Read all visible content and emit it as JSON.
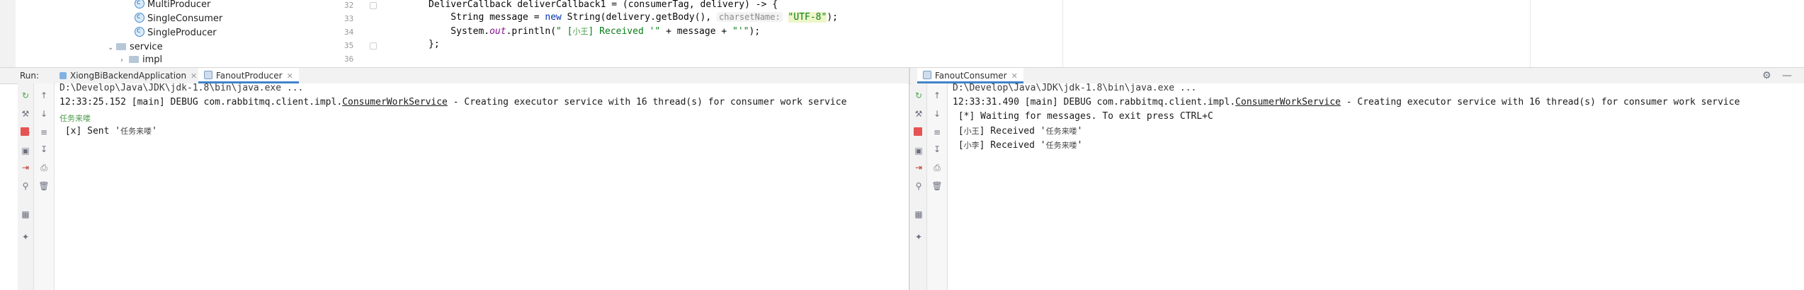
{
  "project_tree": {
    "items": [
      {
        "label": "MultiProducer",
        "kind": "class"
      },
      {
        "label": "SingleConsumer",
        "kind": "class"
      },
      {
        "label": "SingleProducer",
        "kind": "class"
      },
      {
        "label": "service",
        "kind": "folder"
      },
      {
        "label": "impl",
        "kind": "folder"
      }
    ]
  },
  "editor": {
    "line_numbers": [
      "32",
      "33",
      "34",
      "35",
      "36"
    ],
    "lines": [
      {
        "a": "DeliverCallback deliverCallback1 = (consumerTag, delivery) -> {"
      },
      {
        "a": "    String message = ",
        "kw": "new",
        "b": " String(delivery.getBody(), ",
        "hint": "charsetName:",
        "str": "\"UTF-8\"",
        "c": ");"
      },
      {
        "a": "    System.",
        "static": "out",
        "b": ".println(",
        "str1": "\" [",
        "cjk": "小王",
        "str2": "] Received '\"",
        "c": " + message + ",
        "str3": "\"'\"",
        "d": ");"
      },
      {
        "a": "};"
      }
    ]
  },
  "run_window": {
    "run_label": "Run:",
    "left_tabs": [
      {
        "label": "XiongBiBackendApplication",
        "active": false
      },
      {
        "label": "FanoutProducer",
        "active": true
      }
    ],
    "right_tabs": [
      {
        "label": "FanoutConsumer",
        "active": true
      }
    ],
    "producer_console": {
      "path_line": "D:\\Develop\\Java\\JDK\\jdk-1.8\\bin\\java.exe ...",
      "debug_prefix": "12:33:25.152 [main] DEBUG com.rabbitmq.client.impl.",
      "debug_class": "ConsumerWorkService",
      "debug_suffix": " - Creating executor service with 16 thread(s) for consumer work service",
      "line3_cjk": "任务来喽",
      "sent_prefix": " [x] Sent '",
      "sent_msg": "任务来喽",
      "sent_suffix": "'"
    },
    "consumer_console": {
      "path_line": "D:\\Develop\\Java\\JDK\\jdk-1.8\\bin\\java.exe ...",
      "debug_prefix": "12:33:31.490 [main] DEBUG com.rabbitmq.client.impl.",
      "debug_class": "ConsumerWorkService",
      "debug_suffix": " - Creating executor service with 16 thread(s) for consumer work service",
      "waiting": " [*] Waiting for messages. To exit press CTRL+C",
      "received": [
        {
          "open": " [",
          "name": "小王",
          "mid": "] Received '",
          "msg": "任务来喽",
          "close": "'"
        },
        {
          "open": " [",
          "name": "小李",
          "mid": "] Received '",
          "msg": "任务来喽",
          "close": "'"
        }
      ]
    }
  },
  "colors": {
    "accent_tab": "#4083c9",
    "stop_red": "#e55353",
    "rerun_green": "#4ca64c"
  }
}
